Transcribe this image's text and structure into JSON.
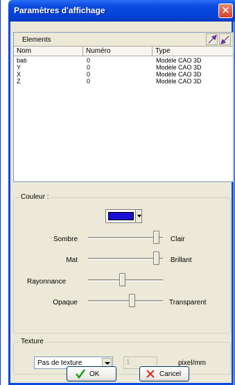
{
  "window": {
    "title": "Paramètres d'affichage",
    "close_glyph": "✕"
  },
  "elements": {
    "header_label": "Elements",
    "columns": [
      "Nom",
      "Numéro",
      "Type"
    ],
    "rows": [
      {
        "nom": "bati",
        "numero": "0",
        "type": "Modèle CAO 3D"
      },
      {
        "nom": "Y",
        "numero": "0",
        "type": "Modèle CAO 3D"
      },
      {
        "nom": "X",
        "numero": "0",
        "type": "Modèle CAO 3D"
      },
      {
        "nom": "Z",
        "numero": "0",
        "type": "Modèle CAO 3D"
      }
    ]
  },
  "couleur": {
    "label": "Couleur :",
    "swatch_color": "#1a0fd2",
    "sliders": [
      {
        "left": "Sombre",
        "right": "Clair",
        "level": 0.95
      },
      {
        "left": "Mat",
        "right": "Brillant",
        "level": 0.95
      },
      {
        "left": "Rayonnance",
        "right": "",
        "level": 0.45
      },
      {
        "left": "Opaque",
        "right": "Transparent",
        "level": 0.6
      }
    ]
  },
  "texture": {
    "label": "Texture",
    "selected": "Pas de texture",
    "value": "1",
    "unit": "pixel/mm"
  },
  "buttons": {
    "ok": "OK",
    "cancel": "Cancel"
  }
}
